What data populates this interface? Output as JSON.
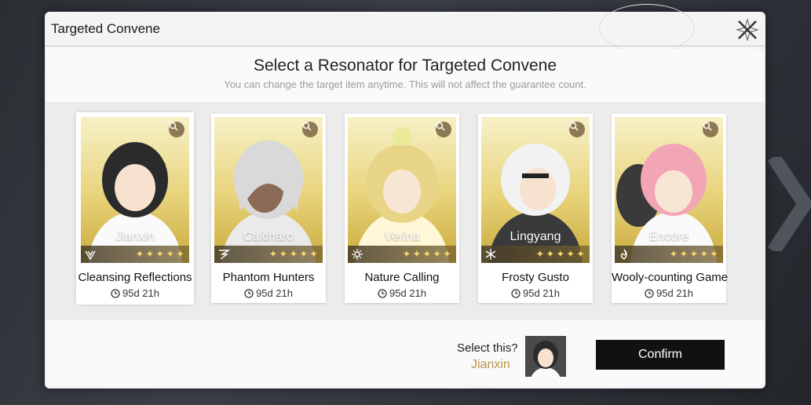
{
  "modal": {
    "title": "Targeted Convene"
  },
  "heading": "Select a Resonator for Targeted Convene",
  "subheading": "You can change the target item anytime. This will not affect the guarantee count.",
  "cards": [
    {
      "character": "Jianxin",
      "banner": "Cleansing Reflections",
      "timer": "95d 21h",
      "element_icon": "wind-icon",
      "hair": "#2b2b2b",
      "selected": true
    },
    {
      "character": "Calcharo",
      "banner": "Phantom Hunters",
      "timer": "95d 21h",
      "element_icon": "electro-icon",
      "hair": "#d9d9d9",
      "selected": false
    },
    {
      "character": "Verina",
      "banner": "Nature Calling",
      "timer": "95d 21h",
      "element_icon": "spectro-icon",
      "hair": "#e8d486",
      "selected": false
    },
    {
      "character": "Lingyang",
      "banner": "Frosty Gusto",
      "timer": "95d 21h",
      "element_icon": "glacio-icon",
      "hair": "#f2f2f2",
      "selected": false
    },
    {
      "character": "Encore",
      "banner": "Wooly-counting Game",
      "timer": "95d 21h",
      "element_icon": "fusion-icon",
      "hair": "#f2a6b5",
      "selected": false
    }
  ],
  "stars": "✦✦✦✦✦",
  "selection": {
    "label": "Select this?",
    "name": "Jianxin"
  },
  "confirm_label": "Confirm",
  "colors": {
    "accent": "#b9954a",
    "card_gold": "#e8d37a",
    "confirm_bg": "#111111"
  }
}
